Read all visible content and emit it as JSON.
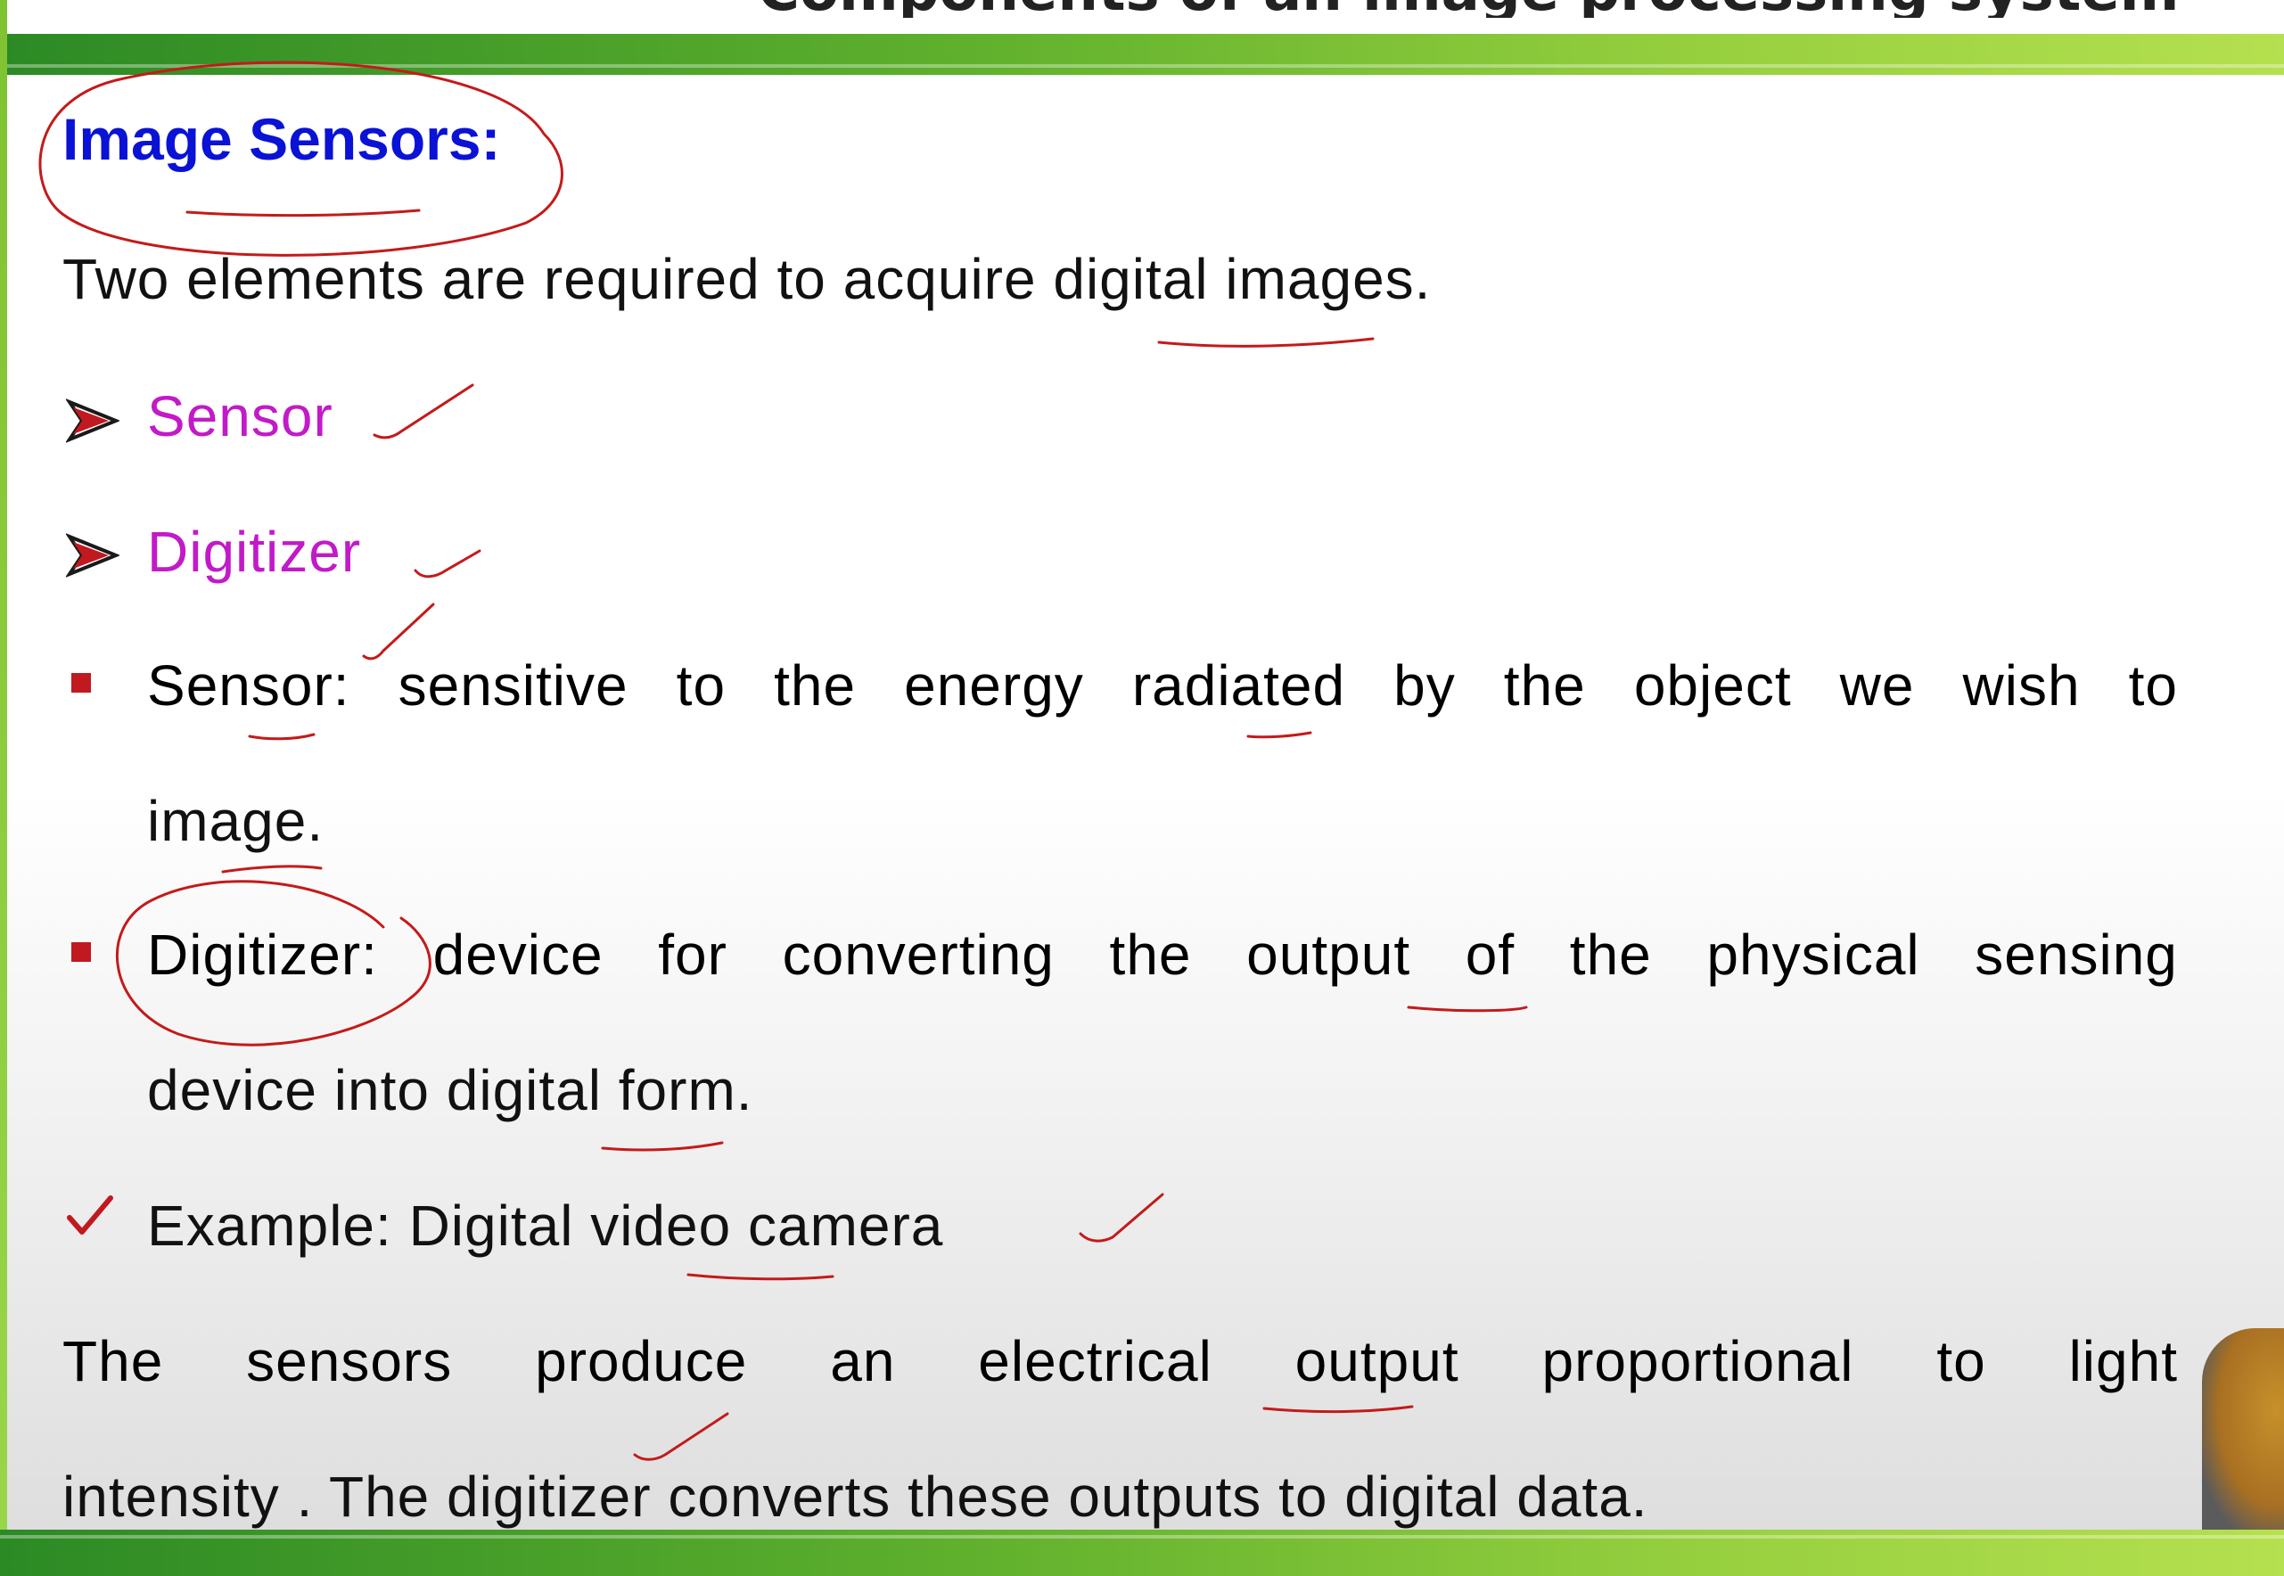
{
  "slide": {
    "header_title": "Components of an image processing system",
    "heading": "Image Sensors:",
    "intro": "Two elements are required to acquire digital images.",
    "arrow_items": [
      "Sensor",
      "Digitizer"
    ],
    "bullet_sensor": {
      "line1": [
        "Sensor:",
        "sensitive",
        "to",
        "the",
        "energy",
        "radiated",
        "by",
        "the",
        "object",
        "we",
        "wish",
        "to"
      ],
      "line2": "image."
    },
    "bullet_digitizer": {
      "line1": [
        "Digitizer:",
        "device",
        "for",
        "converting",
        "the",
        "output",
        "of",
        "the",
        "physical",
        "sensing"
      ],
      "line2": "device into digital form."
    },
    "example": "Example: Digital video camera",
    "closing": {
      "line1": [
        "The",
        "sensors",
        "produce",
        "an",
        "electrical",
        "output",
        "proportional",
        "to",
        "light"
      ],
      "line2": "intensity . The digitizer converts these outputs to digital data."
    }
  },
  "colors": {
    "heading": "#0a12d6",
    "list_accent": "#c21ac8",
    "marker": "#c0191f",
    "annotation_ink": "#c41a1a",
    "bar_green": "#5cae2c"
  }
}
